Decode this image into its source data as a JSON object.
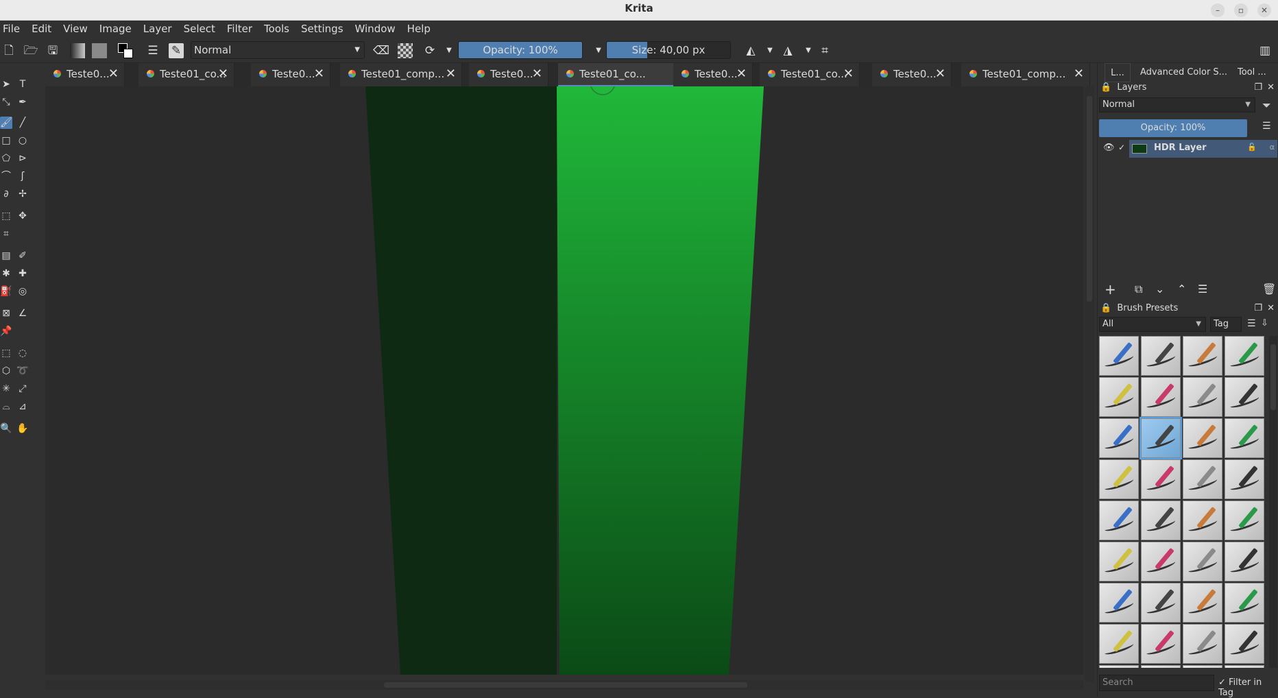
{
  "window": {
    "title": "Krita",
    "minimize": "–",
    "maximize": "▫",
    "close": "✕"
  },
  "menu": [
    "File",
    "Edit",
    "View",
    "Image",
    "Layer",
    "Select",
    "Filter",
    "Tools",
    "Settings",
    "Window",
    "Help"
  ],
  "toolbar": {
    "blend_mode": "Normal",
    "opacity": "Opacity: 100%",
    "opacity_level": 1.0,
    "size": "Size: 40,00 px",
    "size_level": 0.33
  },
  "tabs": [
    {
      "label": "Teste0...",
      "active": false
    },
    {
      "label": "Teste01_co...",
      "active": false
    },
    {
      "label": "Teste0...",
      "active": false
    },
    {
      "label": "Teste01_comp...",
      "active": false
    },
    {
      "label": "Teste0...",
      "active": false
    },
    {
      "label": "Teste01_co...",
      "active": true
    },
    {
      "label": "Teste0...",
      "active": false
    },
    {
      "label": "Teste01_co...",
      "active": false
    },
    {
      "label": "Teste0...",
      "active": false
    },
    {
      "label": "Teste01_comp...",
      "active": false
    }
  ],
  "dock_tabs": [
    "L...",
    "Advanced Color S...",
    "Tool ..."
  ],
  "layers": {
    "title": "Layers",
    "blend_mode": "Normal",
    "opacity": "Opacity:  100%",
    "items": [
      {
        "name": "HDR Layer",
        "visible": true
      }
    ]
  },
  "brush_presets": {
    "title": "Brush Presets",
    "filter": "All",
    "tag": "Tag",
    "search_placeholder": "Search",
    "filter_in_tag": "Filter in Tag"
  },
  "colors": {
    "canvas_bg": "#2b2b2b",
    "dark_strip": "#0e2a12",
    "bright_top": "#20b83a",
    "bright_bottom": "#0b4a16",
    "accent": "#4f7eb0"
  }
}
